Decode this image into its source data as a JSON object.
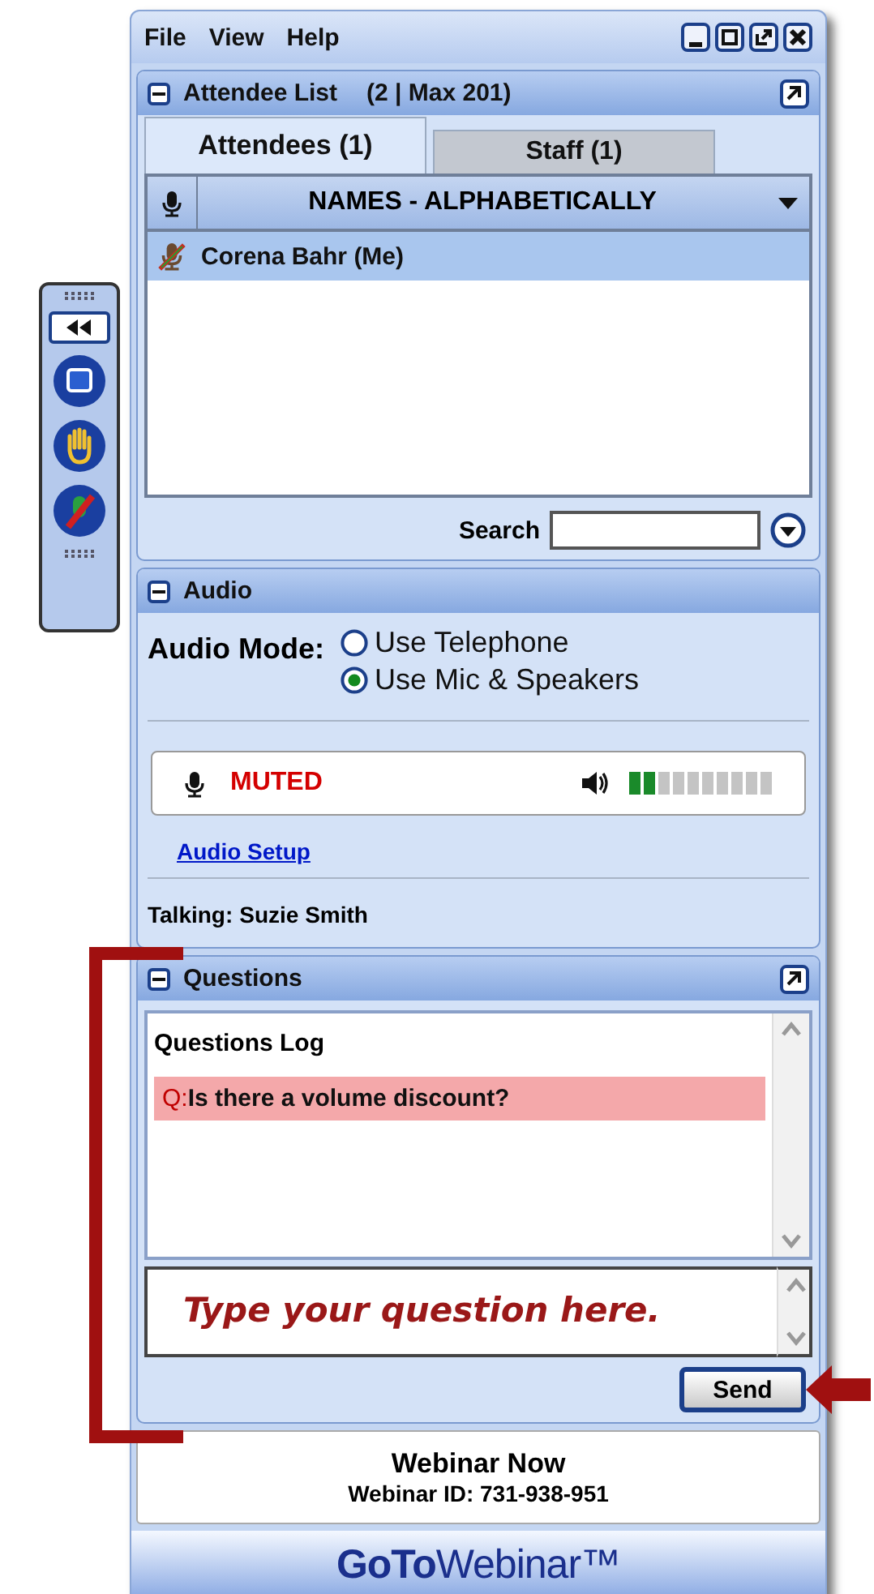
{
  "menu": [
    {
      "label": "File"
    },
    {
      "label": "View"
    },
    {
      "label": "Help"
    }
  ],
  "attendee_list": {
    "title": "Attendee List",
    "count": "(2 | Max 201)",
    "tabs": [
      {
        "label": "Attendees (1)",
        "selected": true
      },
      {
        "label": "Staff (1)",
        "selected": false
      }
    ],
    "column": "NAMES - ALPHABETICALLY",
    "rows": [
      {
        "name": "Corena Bahr (Me)",
        "muted": true,
        "selected": true
      }
    ],
    "search_label": "Search"
  },
  "audio": {
    "title": "Audio",
    "mode_label": "Audio Mode:",
    "options": [
      {
        "label": "Use Telephone",
        "selected": false
      },
      {
        "label": "Use Mic & Speakers",
        "selected": true
      }
    ],
    "mic_status": "MUTED",
    "level": 0.2,
    "setup_link": "Audio Setup",
    "talking_label": "Talking:",
    "talking_name": "Suzie Smith"
  },
  "questions": {
    "title": "Questions",
    "log_title": "Questions Log",
    "items": [
      {
        "prefix": "Q:",
        "text": "Is there a volume discount?",
        "selected": true
      }
    ],
    "input": {
      "placeholder": "Type your question here."
    },
    "send": "Send"
  },
  "footer": {
    "title": "Webinar Now",
    "webinar_id": "Webinar ID: 731-938-951",
    "logo": "**GoTo**Webinar™"
  }
}
